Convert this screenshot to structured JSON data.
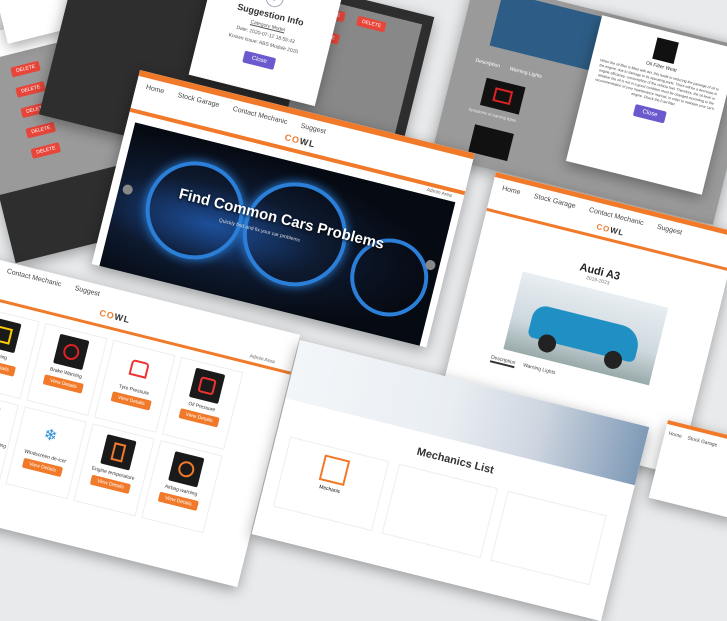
{
  "modal": {
    "title": "Suggestion Info",
    "link": "Category Model",
    "date": "Date: 2020-07-12 18:55:43",
    "issue": "Known Issue: ABS Module 2020",
    "close": "Close"
  },
  "filter_modal": {
    "title": "Oil Filter Wear",
    "body": "When the oil filter is filled with dirt, this leads to reducing the passage of oil to the engine, due to damage to its operating parts. There will be a decrease in engine efficiency, consumption of the vehicle fuel. Therefore, the oil level or whether the oil is not in a good condition must be changed according to the recommendation of your maintenance manual, in order to maintain your car's engine. Check the Fuel filter.",
    "close": "Close"
  },
  "hero": {
    "logo_c": "C",
    "logo_o": "O",
    "logo_rest": "WL",
    "nav": [
      "Home",
      "Stock Garage",
      "Contact Mechanic",
      "Suggest"
    ],
    "admin": "Admin Area",
    "headline": "Find Common Cars Problems",
    "sub": "Quickly find and fix your car problems"
  },
  "car_page": {
    "nav": [
      "Home",
      "Stock Garage",
      "Contact Mechanic",
      "Suggest"
    ],
    "car_name": "Audi A3",
    "years": "2019-2023",
    "tabs": [
      "Description",
      "Warning Lights"
    ]
  },
  "lights_page": {
    "nav": [
      "Contact Mechanic",
      "Suggest"
    ],
    "admin": "Admin Area",
    "items": [
      "Warning",
      "Brake Warning",
      "Tyre Pressure",
      "Oil Pressure",
      "Low washer water warning",
      "Windscreen de-icer",
      "Engine temperature",
      "Airbag warning"
    ],
    "more": "View Details"
  },
  "left_panel": {
    "header": "Options",
    "delete": "DELETE"
  },
  "right_panel": {
    "tabs": [
      "Description",
      "Warning Lights"
    ],
    "caption": "Symptoms of warning lights"
  },
  "mechanics": {
    "title": "Mechanics List",
    "cards": [
      "Mechanic",
      "Mechanic",
      "Mechanic"
    ]
  },
  "bottom_right": {
    "nav": [
      "Home",
      "Stock Garage"
    ]
  }
}
